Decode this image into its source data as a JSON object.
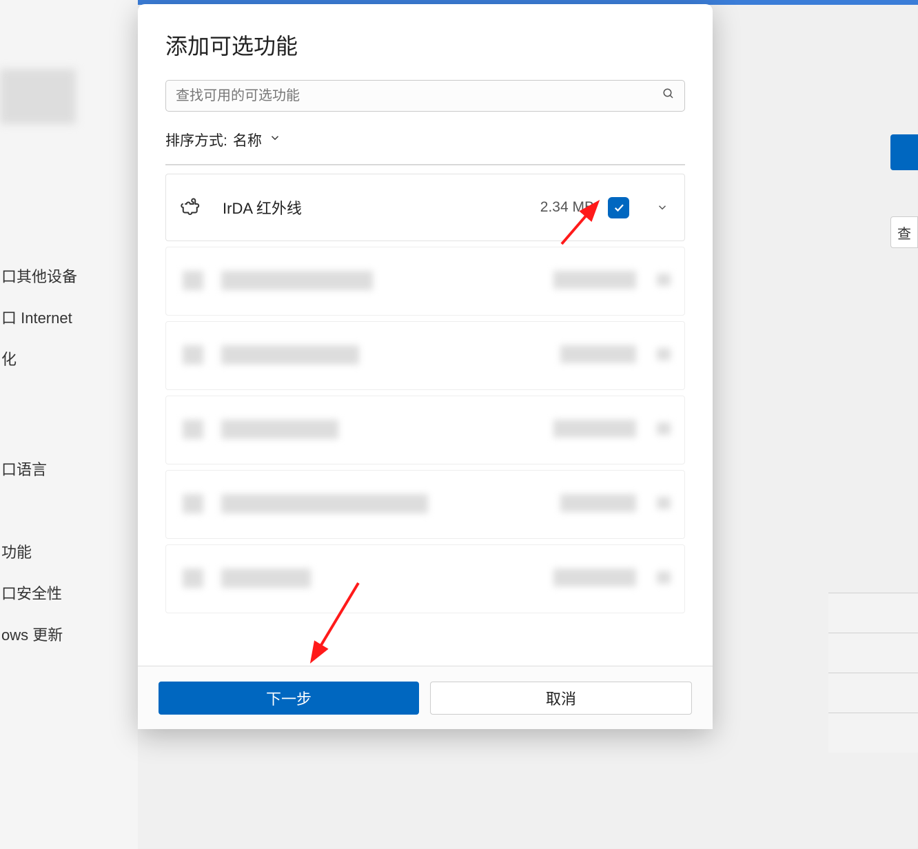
{
  "background": {
    "nav_items": [
      "口其他设备",
      "口 Internet",
      "化",
      "口语言",
      "功能",
      "口安全性",
      "ows 更新"
    ],
    "right_btn2_label": "查"
  },
  "dialog": {
    "title": "添加可选功能",
    "search": {
      "placeholder": "查找可用的可选功能"
    },
    "sort": {
      "label": "排序方式:",
      "value": "名称"
    },
    "feature": {
      "name": "IrDA 红外线",
      "size": "2.34 MB",
      "checked": true
    },
    "buttons": {
      "primary": "下一步",
      "secondary": "取消"
    }
  },
  "colors": {
    "accent": "#0067c0"
  }
}
